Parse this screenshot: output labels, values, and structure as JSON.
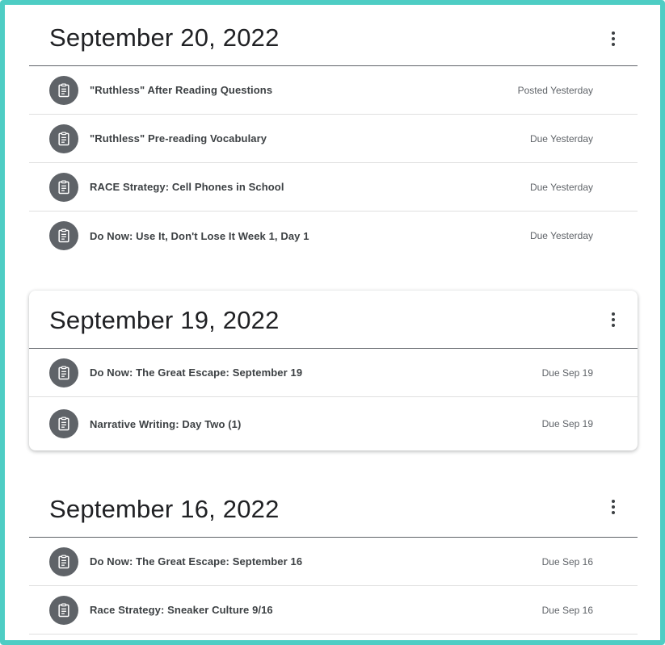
{
  "sections": [
    {
      "date": "September 20, 2022",
      "items": [
        {
          "title": "\"Ruthless\" After Reading Questions",
          "status": "Posted Yesterday"
        },
        {
          "title": "\"Ruthless\" Pre-reading Vocabulary",
          "status": "Due Yesterday"
        },
        {
          "title": "RACE Strategy: Cell Phones in School",
          "status": "Due Yesterday"
        },
        {
          "title": "Do Now: Use It, Don't Lose It Week 1, Day 1",
          "status": "Due Yesterday"
        }
      ]
    },
    {
      "date": "September 19, 2022",
      "items": [
        {
          "title": "Do Now: The Great Escape: September 19",
          "status": "Due Sep 19"
        },
        {
          "title": "Narrative Writing: Day Two (1)",
          "status": "Due Sep 19"
        }
      ]
    },
    {
      "date": "September 16, 2022",
      "items": [
        {
          "title": "Do Now: The Great Escape: September 16",
          "status": "Due Sep 16"
        },
        {
          "title": "Race Strategy: Sneaker Culture 9/16",
          "status": "Due Sep 16"
        }
      ]
    }
  ],
  "icons": {
    "item_icon": "assignment-icon",
    "more_icon": "more-vert-icon"
  },
  "colors": {
    "frame_border": "#4ecdc4",
    "icon_bg": "#5f6368"
  }
}
